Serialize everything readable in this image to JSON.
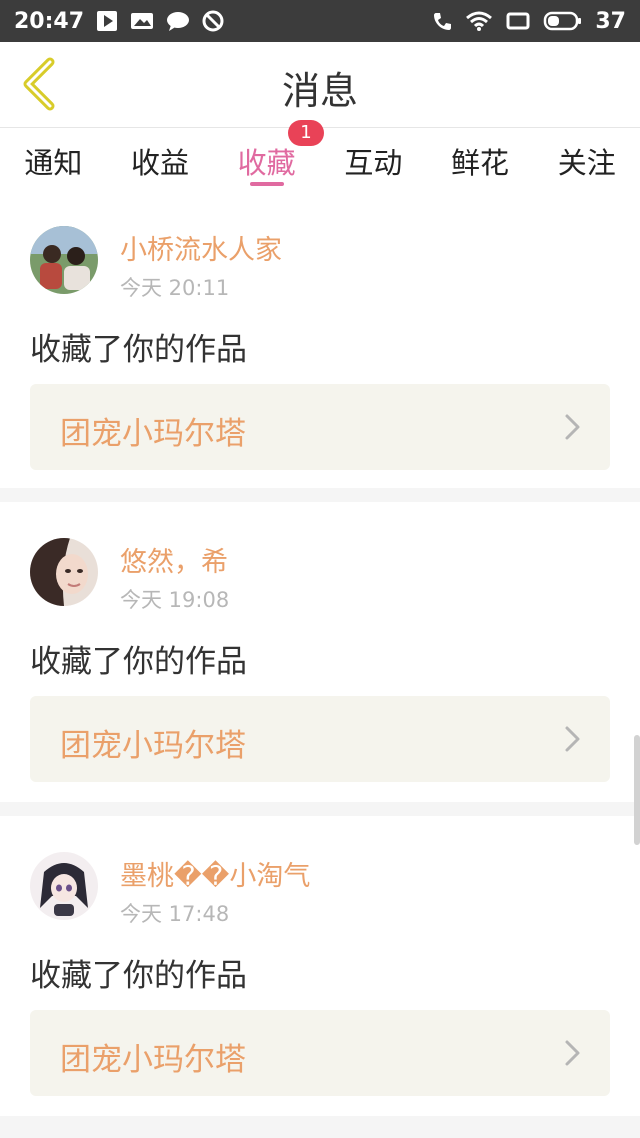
{
  "status_bar": {
    "time": "20:47",
    "battery": "37"
  },
  "header": {
    "title": "消息"
  },
  "tabs": [
    {
      "label": "通知"
    },
    {
      "label": "收益"
    },
    {
      "label": "收藏",
      "badge": "1"
    },
    {
      "label": "互动"
    },
    {
      "label": "鲜花"
    },
    {
      "label": "关注"
    }
  ],
  "messages": [
    {
      "username": "小桥流水人家",
      "time": "今天 20:11",
      "action": "收藏了你的作品",
      "work_title": "团宠小玛尔塔"
    },
    {
      "username": "悠然，希",
      "time": "今天 19:08",
      "action": "收藏了你的作品",
      "work_title": "团宠小玛尔塔"
    },
    {
      "username": "墨桃��小淘气",
      "time": "今天 17:48",
      "action": "收藏了你的作品",
      "work_title": "团宠小玛尔塔"
    }
  ],
  "colors": {
    "accent": "#e06aa0",
    "username": "#eaa06a",
    "badge": "#e94257",
    "back_icon": "#d8cc2a"
  }
}
